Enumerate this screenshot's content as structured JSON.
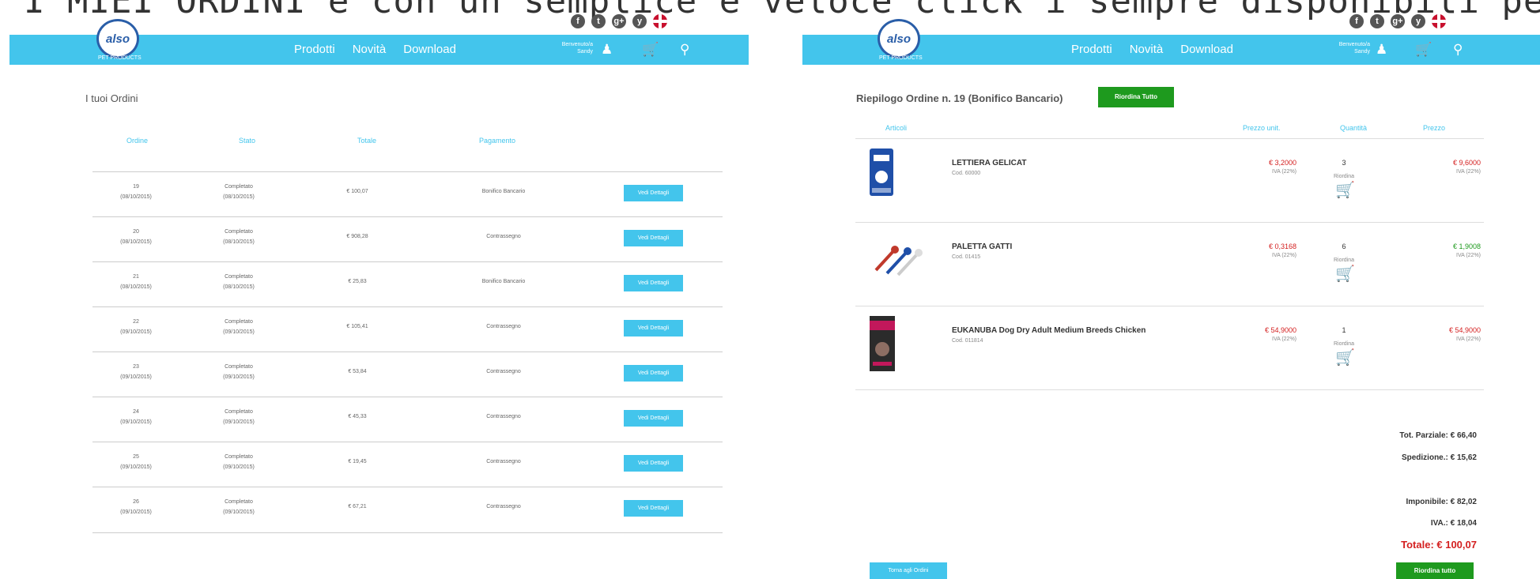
{
  "banner": "I MIEI ORDINI e con un semplice e veloce click i sempre disponibili per riordinare lo stesso ordine",
  "header": {
    "social": [
      "f",
      "t",
      "g+",
      "y",
      ""
    ],
    "logo": "also",
    "logo_sub": "PET PRODUCTS",
    "nav": [
      "Prodotti",
      "Novità",
      "Download"
    ],
    "welcome_line1": "Benvenuto/a",
    "welcome_line2": "Sandy"
  },
  "orders_page": {
    "title": "I tuoi Ordini",
    "columns": [
      "Ordine",
      "Stato",
      "Totale",
      "Pagamento"
    ],
    "button": "Vedi Dettagli",
    "rows": [
      {
        "order": "19",
        "date": "(08/10/2015)",
        "status": "Completato",
        "status_date": "(08/10/2015)",
        "total": "€ 100,07",
        "payment": "Bonifico Bancario"
      },
      {
        "order": "20",
        "date": "(08/10/2015)",
        "status": "Completato",
        "status_date": "(08/10/2015)",
        "total": "€ 908,28",
        "payment": "Contrassegno"
      },
      {
        "order": "21",
        "date": "(08/10/2015)",
        "status": "Completato",
        "status_date": "(08/10/2015)",
        "total": "€ 25,83",
        "payment": "Bonifico Bancario"
      },
      {
        "order": "22",
        "date": "(09/10/2015)",
        "status": "Completato",
        "status_date": "(09/10/2015)",
        "total": "€ 105,41",
        "payment": "Contrassegno"
      },
      {
        "order": "23",
        "date": "(09/10/2015)",
        "status": "Completato",
        "status_date": "(09/10/2015)",
        "total": "€ 53,84",
        "payment": "Contrassegno"
      },
      {
        "order": "24",
        "date": "(09/10/2015)",
        "status": "Completato",
        "status_date": "(09/10/2015)",
        "total": "€ 45,33",
        "payment": "Contrassegno"
      },
      {
        "order": "25",
        "date": "(09/10/2015)",
        "status": "Completato",
        "status_date": "(09/10/2015)",
        "total": "€ 19,45",
        "payment": "Contrassegno"
      },
      {
        "order": "26",
        "date": "(09/10/2015)",
        "status": "Completato",
        "status_date": "(09/10/2015)",
        "total": "€ 67,21",
        "payment": "Contrassegno"
      }
    ]
  },
  "detail_page": {
    "title": "Riepilogo Ordine n. 19 (Bonifico Bancario)",
    "reorder_all_top": "Riordina Tutto",
    "columns": [
      "Articoli",
      "Prezzo unit.",
      "Quantità",
      "Prezzo"
    ],
    "reorder_label": "Riordina",
    "items": [
      {
        "name": "LETTIERA GELICAT",
        "code": "Cod. 60000",
        "unit_price": "€ 3,2000",
        "unit_iva": "IVA (22%)",
        "qty": "3",
        "price": "€ 9,6000",
        "price_iva": "IVA (22%)"
      },
      {
        "name": "PALETTA GATTI",
        "code": "Cod. 01415",
        "unit_price": "€ 0,3168",
        "unit_iva": "IVA (22%)",
        "qty": "6",
        "price": "€ 1,9008",
        "price_iva": "IVA (22%)"
      },
      {
        "name": "EUKANUBA Dog Dry Adult Medium Breeds Chicken",
        "code": "Cod. 011814",
        "unit_price": "€ 54,9000",
        "unit_iva": "IVA (22%)",
        "qty": "1",
        "price": "€ 54,9000",
        "price_iva": "IVA (22%)"
      }
    ],
    "subtotal": "Tot. Parziale: € 66,40",
    "shipping": "Spedizione.: € 15,62",
    "taxable": "Imponibile: € 82,02",
    "vat": "IVA.: € 18,04",
    "total": "Totale: € 100,07",
    "back_button": "Torna agli Ordini",
    "reorder_all_bottom": "Riordina tutto"
  },
  "colors": {
    "accent": "#43c5ec",
    "green": "#1e9a1e",
    "red": "#d42020"
  }
}
